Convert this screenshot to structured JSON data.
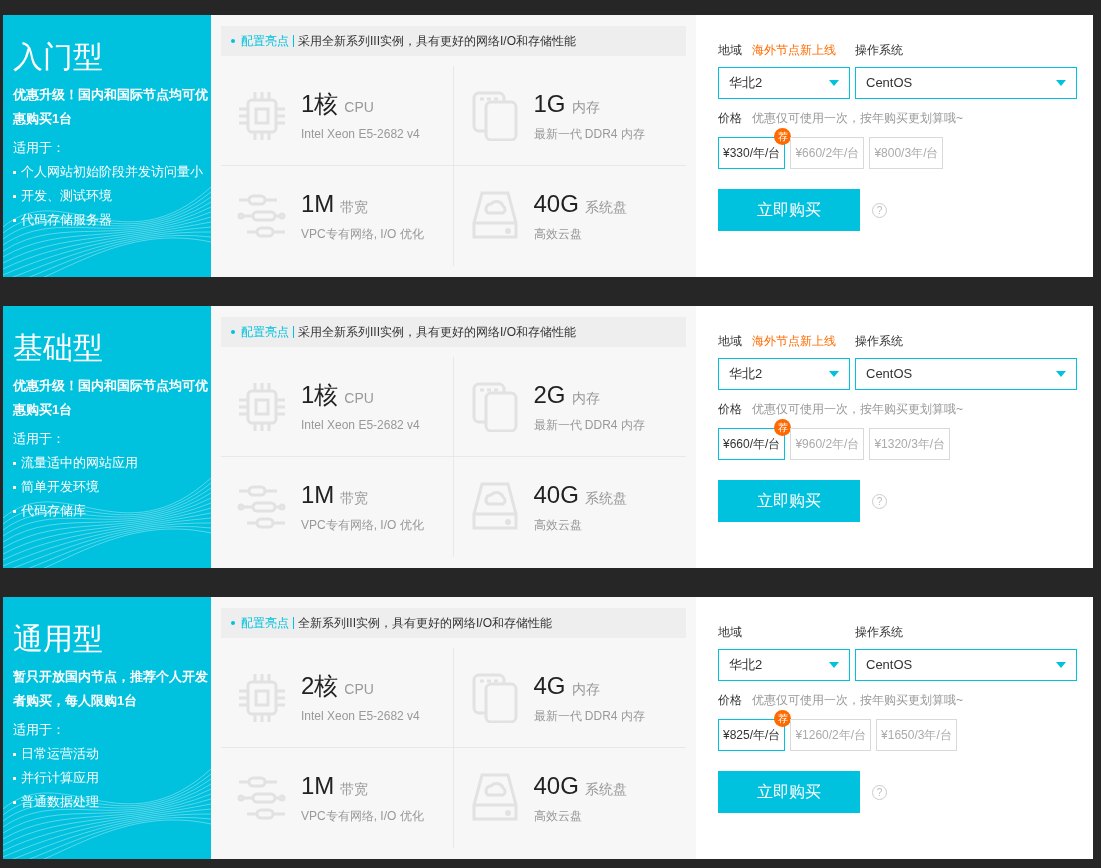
{
  "plans": [
    {
      "title": "入门型",
      "promo": "优惠升级！国内和国际节点均可优惠购买1台",
      "suitable_label": "适用于：",
      "uses": [
        "个人网站初始阶段并发访问量小",
        "开发、测试环境",
        "代码存储服务器"
      ],
      "highlight_label": "配置亮点",
      "highlight_text": "采用全新系列III实例，具有更好的网络I/O和存储性能",
      "specs": [
        {
          "kind": "cpu",
          "value": "1核",
          "unit": "CPU",
          "desc": "Intel Xeon E5-2682 v4"
        },
        {
          "kind": "memory",
          "value": "1G",
          "unit": "内存",
          "desc": "最新一代 DDR4 内存"
        },
        {
          "kind": "network",
          "value": "1M",
          "unit": "带宽",
          "desc": "VPC专有网络, I/O 优化"
        },
        {
          "kind": "disk",
          "value": "40G",
          "unit": "系统盘",
          "desc": "高效云盘"
        }
      ],
      "region_label": "地域",
      "region_note": "海外节点新上线",
      "os_label": "操作系统",
      "region_value": "华北2",
      "os_value": "CentOS",
      "price_label": "价格",
      "price_note": "优惠仅可使用一次，按年购买更划算哦~",
      "prices": [
        {
          "text": "¥330/年/台",
          "selected": true,
          "badge": "荐"
        },
        {
          "text": "¥660/2年/台",
          "selected": false
        },
        {
          "text": "¥800/3年/台",
          "selected": false
        }
      ],
      "buy_button": "立即购买",
      "help_icon": "?"
    },
    {
      "title": "基础型",
      "promo": "优惠升级！国内和国际节点均可优惠购买1台",
      "suitable_label": "适用于：",
      "uses": [
        "流量适中的网站应用",
        "简单开发环境",
        "代码存储库"
      ],
      "highlight_label": "配置亮点",
      "highlight_text": "采用全新系列III实例，具有更好的网络I/O和存储性能",
      "specs": [
        {
          "kind": "cpu",
          "value": "1核",
          "unit": "CPU",
          "desc": "Intel Xeon E5-2682 v4"
        },
        {
          "kind": "memory",
          "value": "2G",
          "unit": "内存",
          "desc": "最新一代 DDR4 内存"
        },
        {
          "kind": "network",
          "value": "1M",
          "unit": "带宽",
          "desc": "VPC专有网络, I/O 优化"
        },
        {
          "kind": "disk",
          "value": "40G",
          "unit": "系统盘",
          "desc": "高效云盘"
        }
      ],
      "region_label": "地域",
      "region_note": "海外节点新上线",
      "os_label": "操作系统",
      "region_value": "华北2",
      "os_value": "CentOS",
      "price_label": "价格",
      "price_note": "优惠仅可使用一次，按年购买更划算哦~",
      "prices": [
        {
          "text": "¥660/年/台",
          "selected": true,
          "badge": "荐"
        },
        {
          "text": "¥960/2年/台",
          "selected": false
        },
        {
          "text": "¥1320/3年/台",
          "selected": false
        }
      ],
      "buy_button": "立即购买",
      "help_icon": "?"
    },
    {
      "title": "通用型",
      "promo": "暂只开放国内节点，推荐个人开发者购买，每人限购1台",
      "suitable_label": "适用于：",
      "uses": [
        "日常运营活动",
        "并行计算应用",
        "普通数据处理"
      ],
      "highlight_label": "配置亮点",
      "highlight_text": "全新系列III实例，具有更好的网络I/O和存储性能",
      "specs": [
        {
          "kind": "cpu",
          "value": "2核",
          "unit": "CPU",
          "desc": "Intel Xeon E5-2682 v4"
        },
        {
          "kind": "memory",
          "value": "4G",
          "unit": "内存",
          "desc": "最新一代 DDR4 内存"
        },
        {
          "kind": "network",
          "value": "1M",
          "unit": "带宽",
          "desc": "VPC专有网络, I/O 优化"
        },
        {
          "kind": "disk",
          "value": "40G",
          "unit": "系统盘",
          "desc": "高效云盘"
        }
      ],
      "region_label": "地域",
      "os_label": "操作系统",
      "region_value": "华北2",
      "os_value": "CentOS",
      "price_label": "价格",
      "price_note": "优惠仅可使用一次，按年购买更划算哦~",
      "prices": [
        {
          "text": "¥825/年/台",
          "selected": true,
          "badge": "荐"
        },
        {
          "text": "¥1260/2年/台",
          "selected": false
        },
        {
          "text": "¥1650/3年/台",
          "selected": false
        }
      ],
      "buy_button": "立即购买",
      "help_icon": "?"
    }
  ]
}
